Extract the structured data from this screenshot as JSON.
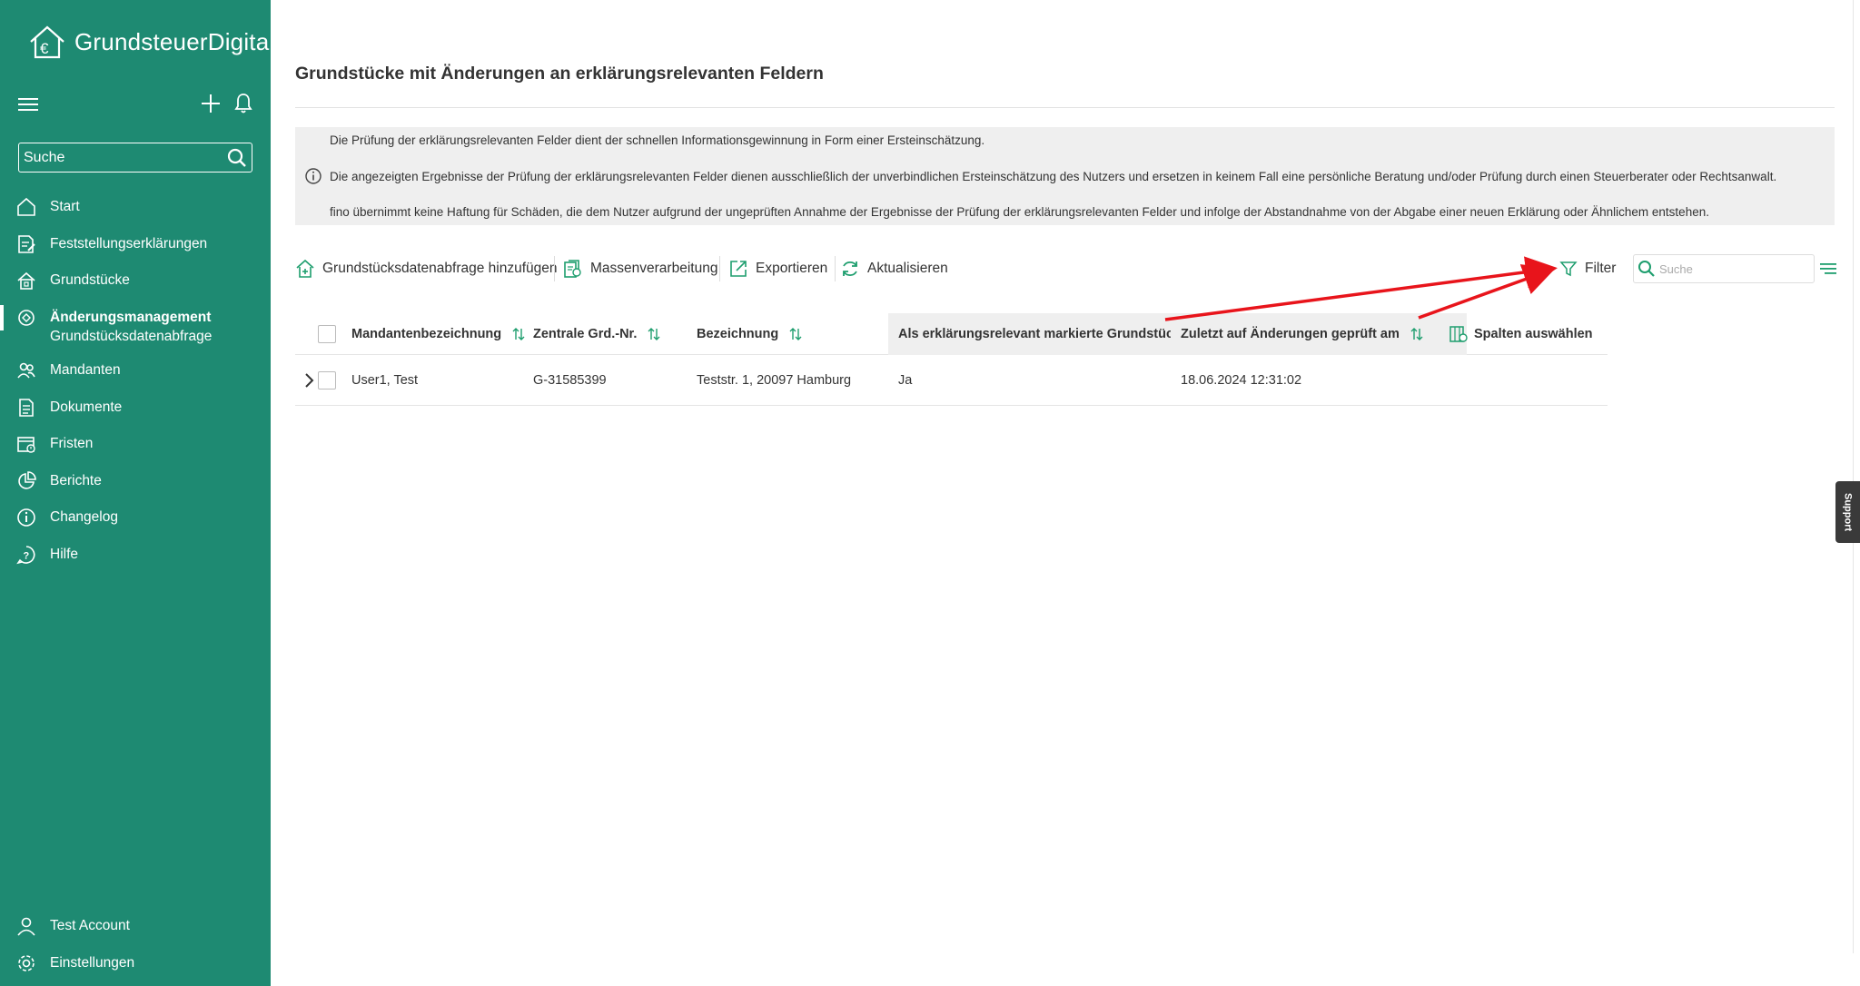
{
  "app": {
    "name": "GrundsteuerDigital"
  },
  "sidebar": {
    "search_placeholder": "Suche",
    "items": [
      {
        "label": "Start",
        "icon": "home-icon"
      },
      {
        "label": "Feststellungserklärungen",
        "icon": "document-edit-icon"
      },
      {
        "label": "Grundstücke",
        "icon": "property-icon"
      },
      {
        "label": "Änderungsmanagement",
        "icon": "change-management-icon",
        "active": true
      },
      {
        "label": "Mandanten",
        "icon": "users-icon"
      },
      {
        "label": "Dokumente",
        "icon": "document-icon"
      },
      {
        "label": "Fristen",
        "icon": "calendar-icon"
      },
      {
        "label": "Berichte",
        "icon": "pie-chart-icon"
      },
      {
        "label": "Changelog",
        "icon": "info-icon"
      },
      {
        "label": "Hilfe",
        "icon": "help-icon"
      }
    ],
    "subitem": "Grundstücksdatenabfrage",
    "bottom": [
      {
        "label": "Test Account",
        "icon": "user-icon"
      },
      {
        "label": "Einstellungen",
        "icon": "gear-icon"
      }
    ]
  },
  "main": {
    "title": "Grundstücke mit Änderungen an erklärungsrelevanten Feldern",
    "info": [
      "Die Prüfung der erklärungsrelevanten Felder dient der schnellen Informationsgewinnung in Form einer Ersteinschätzung.",
      "Die angezeigten Ergebnisse der Prüfung der erklärungsrelevanten Felder dienen ausschließlich der unverbindlichen Ersteinschätzung des Nutzers und ersetzen in keinem Fall eine persönliche Beratung und/oder Prüfung durch einen Steuerberater oder Rechtsanwalt.",
      "fino übernimmt keine Haftung für Schäden, die dem Nutzer aufgrund der ungeprüften Annahme der Ergebnisse der Prüfung der erklärungsrelevanten Felder und infolge der Abstandnahme von der Abgabe einer neuen Erklärung oder Ähnlichem entstehen."
    ],
    "toolbar": {
      "add": "Grundstücksdatenabfrage hinzufügen",
      "bulk": "Massenverarbeitung",
      "export": "Exportieren",
      "refresh": "Aktualisieren",
      "filter": "Filter",
      "search_placeholder": "Suche"
    },
    "table": {
      "columns": [
        "Mandantenbezeichnung",
        "Zentrale Grd.-Nr.",
        "Bezeichnung",
        "Als erklärungsrelevant markierte Grundstücke",
        "Zuletzt auf Änderungen geprüft am"
      ],
      "choose_columns": "Spalten auswählen",
      "rows": [
        {
          "client": "User1, Test",
          "number": "G-31585399",
          "designation": "Teststr. 1, 20097 Hamburg",
          "relevant": "Ja",
          "checked": "18.06.2024 12:31:02"
        }
      ]
    }
  },
  "support": "Support",
  "colors": {
    "sidebar": "#1e8a72",
    "accent": "#1e9e6e",
    "annotation": "#e8141b"
  }
}
